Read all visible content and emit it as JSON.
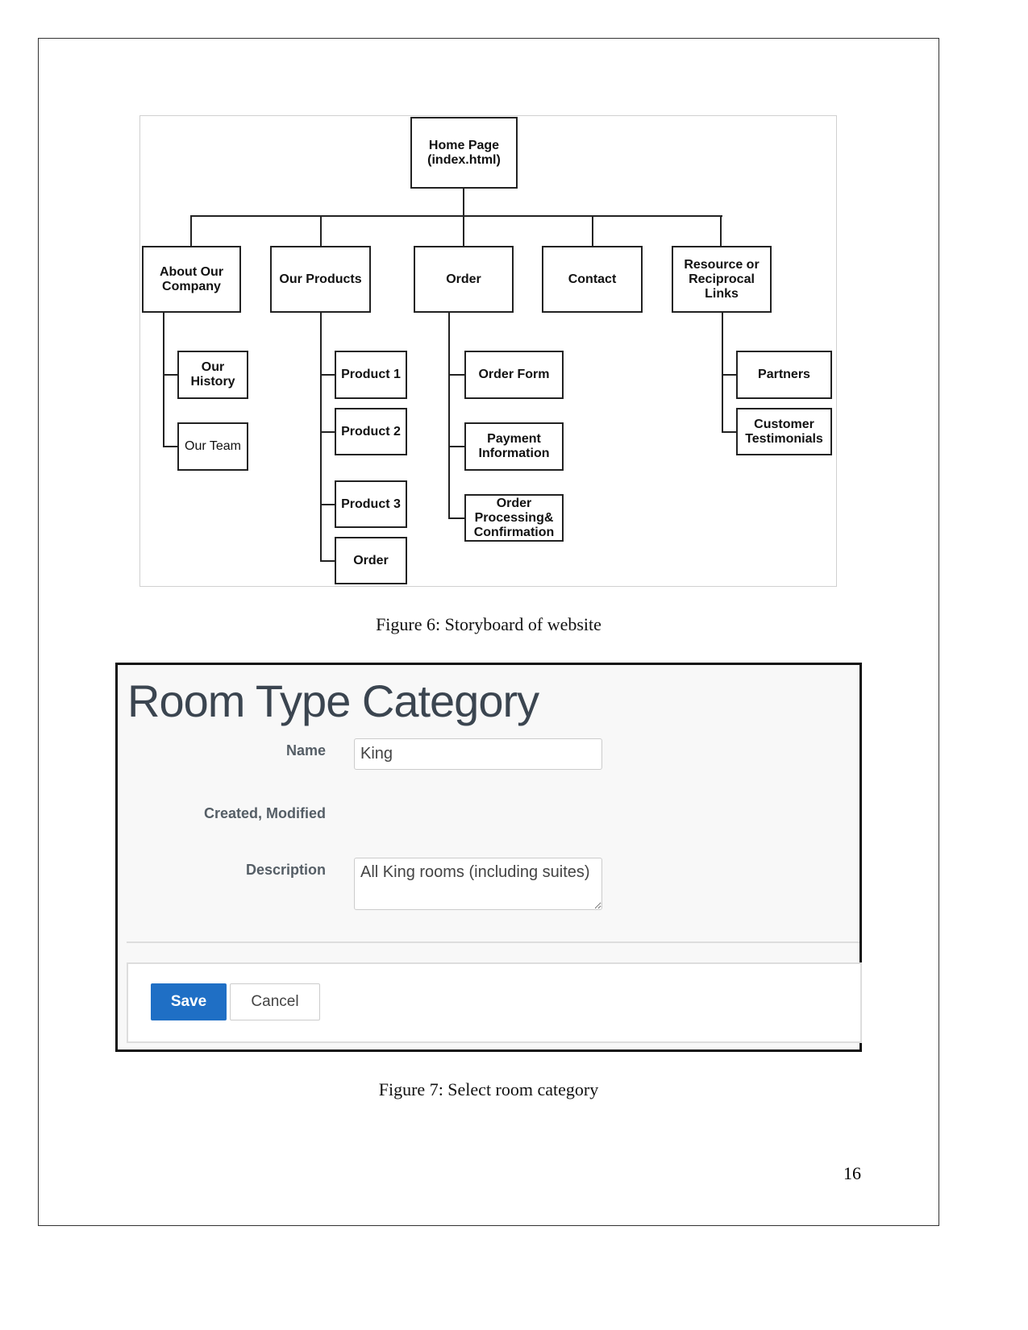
{
  "figure6": {
    "caption": "Figure 6: Storyboard of website",
    "root": "Home Page (index.html)",
    "sections": [
      {
        "label": "About Our Company",
        "children": [
          "Our History",
          "Our Team"
        ]
      },
      {
        "label": "Our Products",
        "children": [
          "Product 1",
          "Product 2",
          "Product 3",
          "Order"
        ]
      },
      {
        "label": "Order",
        "children": [
          "Order Form",
          "Payment Information",
          "Order Processing& Confirmation"
        ]
      },
      {
        "label": "Contact",
        "children": []
      },
      {
        "label": "Resource or Reciprocal Links",
        "children": [
          "Partners",
          "Customer Testimonials"
        ]
      }
    ]
  },
  "figure7": {
    "caption": "Figure 7: Select room category",
    "title": "Room Type Category",
    "name_label": "Name",
    "name_value": "King",
    "created_label": "Created, Modified",
    "description_label": "Description",
    "description_value": "All King rooms (including suites)",
    "save_label": "Save",
    "cancel_label": "Cancel",
    "accent_color": "#1f6fc5"
  },
  "page_number": "16"
}
